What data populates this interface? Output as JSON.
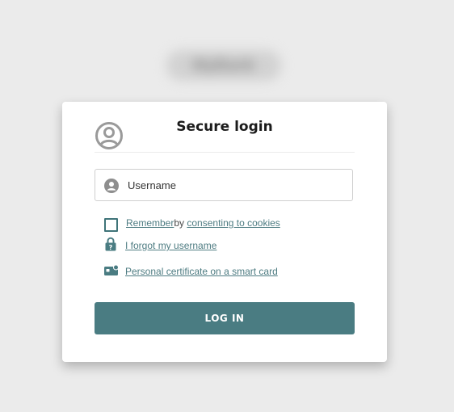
{
  "brand": {
    "logo_text": "MyBank"
  },
  "login_card": {
    "title": "Secure login",
    "username_placeholder": "Username",
    "remember_prefix": "Remember",
    "remember_middle": "by ",
    "remember_link": "consenting to cookies",
    "forgot_username": "I forgot my username",
    "certificate_link": "Personal certificate on a smart card",
    "login_button": "LOG IN"
  },
  "colors": {
    "accent": "#4a7c82",
    "link": "#4e7c82",
    "background": "#ebebeb"
  },
  "icons": {
    "header": "user-circle-icon",
    "username": "person-icon",
    "forgot": "lock-icon",
    "certificate": "smartcard-icon"
  }
}
